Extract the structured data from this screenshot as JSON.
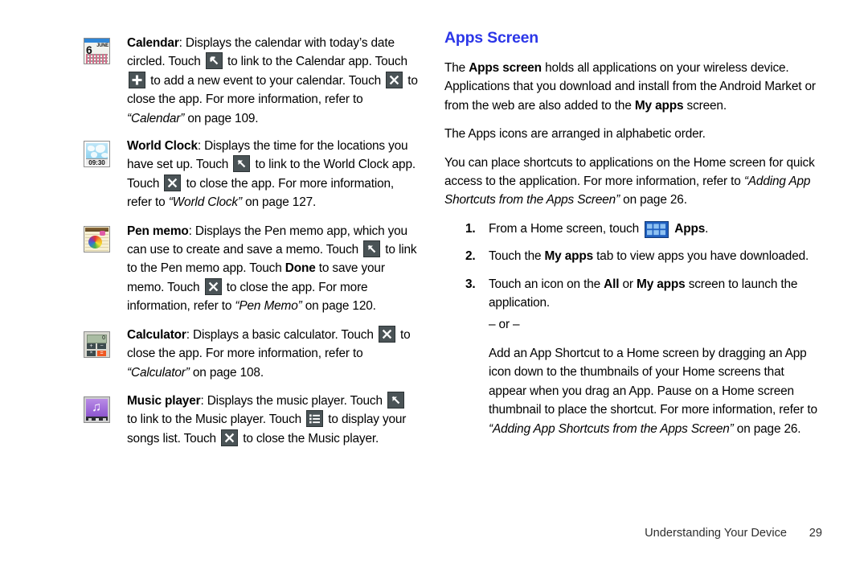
{
  "page": {
    "footer_section": "Understanding Your Device",
    "footer_page_number": "29"
  },
  "left_column": {
    "entries": [
      {
        "icon_name": "calendar-app-icon",
        "icon": {
          "day": "6",
          "month": "JUNE"
        },
        "title": "Calendar",
        "text_segments": [
          {
            "t": "Calendar",
            "style": "bold"
          },
          {
            "t": ": Displays the calendar with today’s date circled. Touch ",
            "style": "normal"
          },
          {
            "t": "link-icon",
            "style": "icon"
          },
          {
            "t": " to link to the Calendar app. Touch ",
            "style": "normal"
          },
          {
            "t": "plus-icon",
            "style": "icon"
          },
          {
            "t": " to add a new event to your calendar. Touch ",
            "style": "normal"
          },
          {
            "t": "close-icon",
            "style": "icon"
          },
          {
            "t": " to close the app. For more information, refer to ",
            "style": "normal"
          },
          {
            "t": "“Calendar”",
            "style": "italic"
          },
          {
            "t": " on page 109.",
            "style": "normal"
          }
        ]
      },
      {
        "icon_name": "world-clock-app-icon",
        "icon": {
          "time": "09:30"
        },
        "title": "World Clock",
        "text_segments": [
          {
            "t": "World Clock",
            "style": "bold"
          },
          {
            "t": ": Displays the time for the locations you have set up. Touch ",
            "style": "normal"
          },
          {
            "t": "link-icon",
            "style": "icon"
          },
          {
            "t": " to link to the World Clock app. Touch ",
            "style": "normal"
          },
          {
            "t": "close-icon",
            "style": "icon"
          },
          {
            "t": " to close the app. For more information, refer to ",
            "style": "normal"
          },
          {
            "t": "“World Clock”",
            "style": "italic"
          },
          {
            "t": " on page 127.",
            "style": "normal"
          }
        ]
      },
      {
        "icon_name": "pen-memo-app-icon",
        "icon": {},
        "title": "Pen memo",
        "text_segments": [
          {
            "t": "Pen memo",
            "style": "bold"
          },
          {
            "t": ": Displays the Pen memo app, which you can use to create and save a memo. Touch ",
            "style": "normal"
          },
          {
            "t": "link-icon",
            "style": "icon"
          },
          {
            "t": " to link to the Pen memo app. Touch ",
            "style": "normal"
          },
          {
            "t": "Done",
            "style": "bold"
          },
          {
            "t": " to save your memo. Touch ",
            "style": "normal"
          },
          {
            "t": "close-icon",
            "style": "icon"
          },
          {
            "t": " to close the app. For more information, refer to ",
            "style": "normal"
          },
          {
            "t": "“Pen Memo”",
            "style": "italic"
          },
          {
            "t": " on page 120.",
            "style": "normal"
          }
        ]
      },
      {
        "icon_name": "calculator-app-icon",
        "icon": {
          "display": "0",
          "keys": [
            "+",
            "−",
            "×",
            "="
          ]
        },
        "title": "Calculator",
        "text_segments": [
          {
            "t": "Calculator",
            "style": "bold"
          },
          {
            "t": ": Displays a basic calculator. Touch ",
            "style": "normal"
          },
          {
            "t": "close-icon",
            "style": "icon"
          },
          {
            "t": " to close the app. For more information, refer to ",
            "style": "normal"
          },
          {
            "t": "“Calculator”",
            "style": "italic"
          },
          {
            "t": " on page 108.",
            "style": "normal"
          }
        ]
      },
      {
        "icon_name": "music-player-app-icon",
        "icon": {},
        "title": "Music player",
        "text_segments": [
          {
            "t": "Music player",
            "style": "bold"
          },
          {
            "t": ": Displays the music player. Touch ",
            "style": "normal"
          },
          {
            "t": "link-icon",
            "style": "icon"
          },
          {
            "t": " to link to the Music player. Touch ",
            "style": "normal"
          },
          {
            "t": "list-icon",
            "style": "icon"
          },
          {
            "t": " to display your songs list. Touch ",
            "style": "normal"
          },
          {
            "t": "close-icon",
            "style": "icon"
          },
          {
            "t": " to close the Music player.",
            "style": "normal"
          }
        ]
      }
    ]
  },
  "right_column": {
    "title": "Apps Screen",
    "paragraphs": [
      [
        {
          "t": "The ",
          "style": "normal"
        },
        {
          "t": "Apps screen",
          "style": "bold"
        },
        {
          "t": " holds all applications on your wireless device. Applications that you download and install from the Android Market or from the web are also added to the ",
          "style": "normal"
        },
        {
          "t": "My apps",
          "style": "bold"
        },
        {
          "t": " screen.",
          "style": "normal"
        }
      ],
      [
        {
          "t": "The Apps icons are arranged in alphabetic order.",
          "style": "normal"
        }
      ],
      [
        {
          "t": "You can place shortcuts to applications on the Home screen for quick access to the application. For more information, refer to ",
          "style": "normal"
        },
        {
          "t": "“Adding App Shortcuts from the Apps Screen”",
          "style": "italic"
        },
        {
          "t": " on page 26.",
          "style": "normal"
        }
      ]
    ],
    "steps": [
      {
        "num": "1.",
        "segments": [
          {
            "t": "From a Home screen, touch ",
            "style": "normal"
          },
          {
            "t": "apps-grid-icon",
            "style": "icon"
          },
          {
            "t": " ",
            "style": "normal"
          },
          {
            "t": "Apps",
            "style": "bold"
          },
          {
            "t": ".",
            "style": "normal"
          }
        ]
      },
      {
        "num": "2.",
        "segments": [
          {
            "t": "Touch the ",
            "style": "normal"
          },
          {
            "t": "My apps",
            "style": "bold"
          },
          {
            "t": " tab to view apps you have downloaded.",
            "style": "normal"
          }
        ]
      },
      {
        "num": "3.",
        "segments": [
          {
            "t": "Touch an icon on the ",
            "style": "normal"
          },
          {
            "t": "All",
            "style": "bold"
          },
          {
            "t": " or ",
            "style": "normal"
          },
          {
            "t": "My apps",
            "style": "bold"
          },
          {
            "t": " screen to launch the application.",
            "style": "normal"
          }
        ]
      }
    ],
    "or_separator": "– or –",
    "trailing_paragraph": [
      {
        "t": "Add an App Shortcut to a Home screen by dragging an App icon down to the thumbnails of your Home screens that appear when you drag an App. Pause on a Home screen thumbnail to place the shortcut. For more information, refer to ",
        "style": "normal"
      },
      {
        "t": "“Adding App Shortcuts from the Apps Screen”",
        "style": "italic"
      },
      {
        "t": " on page 26.",
        "style": "normal"
      }
    ]
  },
  "colors": {
    "heading_blue": "#2B36E8",
    "inline_icon_bg": "#4a5356",
    "apps_icon_blue": "#1f5fbf",
    "calculator_equals_orange": "#ef5822",
    "music_player_purple": "#9a66d6"
  }
}
